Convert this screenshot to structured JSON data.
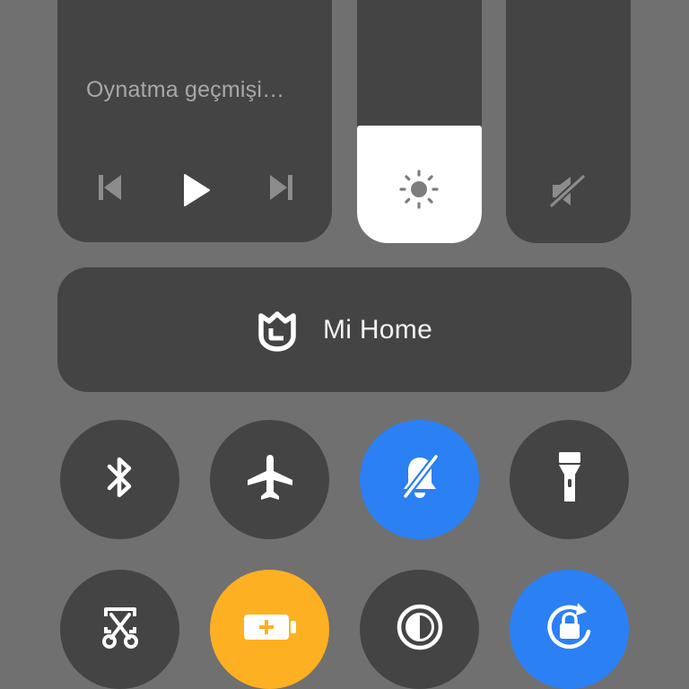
{
  "media": {
    "title": "Oynatma geçmişi…",
    "controls": [
      "previous",
      "play",
      "next"
    ]
  },
  "brightness": {
    "level_fraction": 0.42,
    "icon": "sun-icon"
  },
  "volume": {
    "level_fraction": 0,
    "icon": "volume-mute-icon"
  },
  "mi_home": {
    "label": "Mi Home",
    "icon": "mi-home-logo"
  },
  "toggles_row1": [
    {
      "name": "bluetooth",
      "icon": "bluetooth-icon",
      "active": false
    },
    {
      "name": "airplane-mode",
      "icon": "airplane-icon",
      "active": false
    },
    {
      "name": "silent-mode",
      "icon": "bell-off-icon",
      "active": true
    },
    {
      "name": "flashlight",
      "icon": "flashlight-icon",
      "active": false
    }
  ],
  "toggles_row2": [
    {
      "name": "screenshot",
      "icon": "scissors-icon",
      "active": false
    },
    {
      "name": "battery-saver",
      "icon": "battery-plus-icon",
      "active": true
    },
    {
      "name": "dark-mode",
      "icon": "contrast-icon",
      "active": false
    },
    {
      "name": "rotation-lock",
      "icon": "rotation-lock-icon",
      "active": true
    }
  ],
  "colors": {
    "background": "#707070",
    "tile": "#444444",
    "active_blue": "#2b80f4",
    "battery_yellow": "#fdb022",
    "slider_fill": "#ffffff"
  }
}
